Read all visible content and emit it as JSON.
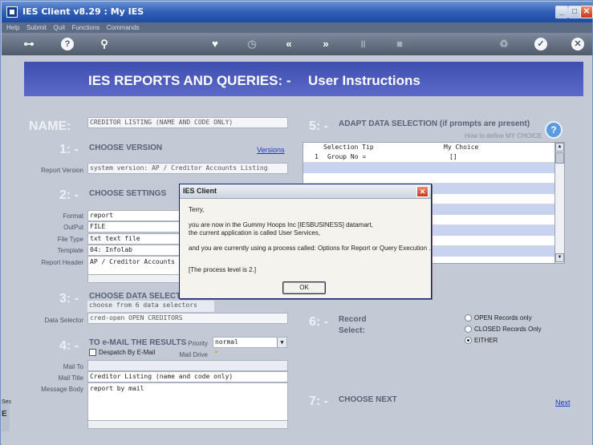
{
  "window": {
    "title": "IES Client v8.29 : My IES",
    "controls": [
      "_",
      "□",
      "✕"
    ]
  },
  "menu": [
    "Help",
    "Submit",
    "Quit",
    "Functions",
    "Commands"
  ],
  "toolbar": {
    "icons": [
      "key-icon",
      "help-icon",
      "search-icon",
      "heart-icon",
      "clock-icon",
      "rewind-icon",
      "fast-forward-icon",
      "pause-icon",
      "stop-icon",
      "recycle-icon",
      "check-icon",
      "close-icon"
    ]
  },
  "banner": {
    "title": "IES REPORTS AND QUERIES: -",
    "subtitle": "User Instructions"
  },
  "name": {
    "label": "NAME:",
    "value": "CREDITOR LISTING (NAME AND CODE ONLY)"
  },
  "section1": {
    "number": "1: -",
    "heading": "CHOOSE VERSION",
    "versions_link": "Versions",
    "report_version_label": "Report Version",
    "report_version_value": "system version: AP / Creditor Accounts Listing"
  },
  "section2": {
    "number": "2: -",
    "heading": "CHOOSE SETTINGS",
    "fields": [
      {
        "label": "Format",
        "value": "report"
      },
      {
        "label": "OutPut",
        "value": "FILE"
      },
      {
        "label": "File Type",
        "value": "txt text file"
      },
      {
        "label": "Template",
        "value": "04: Infolab"
      },
      {
        "label": "Report Header",
        "value": "AP / Creditor Accounts"
      }
    ]
  },
  "section3": {
    "number": "3: -",
    "heading": "CHOOSE DATA SELECTOR",
    "info": "choose from 6 data selectors",
    "data_selector_label": "Data Selector",
    "data_selector_value": "cred-open OPEN CREDITORS"
  },
  "section4": {
    "number": "4: -",
    "heading": "TO e-MAIL THE RESULTS",
    "priority_label": "Priority",
    "priority_value": "normal",
    "despatch_label": "Despatch By E-Mail",
    "mail_drive_label": "Mail Drive",
    "mail_drive_value": "*",
    "mail_to_label": "Mail To",
    "mail_title_label": "Mail Title",
    "mail_title_value": "Creditor Listing (name and code only)",
    "message_body_label": "Message Body",
    "message_body_value": "report by mail"
  },
  "section5": {
    "number": "5: -",
    "heading": "ADAPT DATA SELECTION (if prompts are present)",
    "help_link": "How to define MY CHOICE",
    "col_tip": "Selection Tip",
    "col_choice": "My Choice",
    "rows": [
      {
        "n": "1",
        "tip": "Group No =",
        "choice": "[]"
      }
    ]
  },
  "section6": {
    "number": "6: -",
    "heading_line1": "Record",
    "heading_line2": "Select:",
    "options": [
      {
        "label": "OPEN Records only",
        "selected": false
      },
      {
        "label": "CLOSED Records Only",
        "selected": false
      },
      {
        "label": "EITHER",
        "selected": true
      }
    ]
  },
  "section7": {
    "number": "7: -",
    "heading": "CHOOSE NEXT",
    "next_link": "Next"
  },
  "left_stub": {
    "line1": "Ses",
    "line2": "E"
  },
  "dialog": {
    "title": "IES Client",
    "greeting": "Terry,",
    "line1": "you are now in the Gummy Hoops Inc [IESBUSINESS] datamart,",
    "line2": "the current application is called User Services,",
    "line3": "and you are currently using a process called: Options for Report or Query Execution .",
    "line4": "[The process level is 2.]",
    "ok_label": "OK"
  }
}
